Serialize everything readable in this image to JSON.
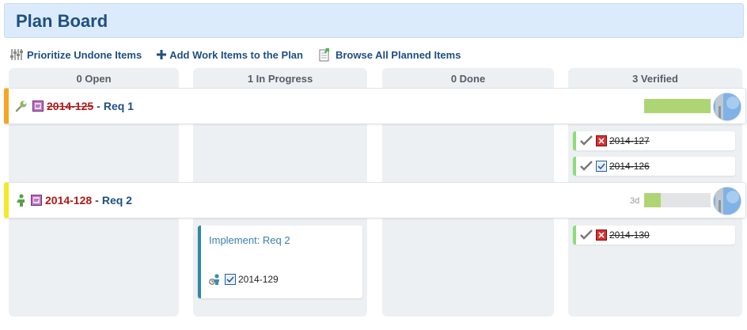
{
  "header": {
    "title": "Plan Board"
  },
  "toolbar": {
    "prioritize_label": "Prioritize Undone Items",
    "add_label": "Add Work Items to the Plan",
    "browse_label": "Browse All Planned Items"
  },
  "columns": [
    {
      "label": "0 Open"
    },
    {
      "label": "1 In Progress"
    },
    {
      "label": "0 Done"
    },
    {
      "label": "3 Verified"
    }
  ],
  "swimlanes": [
    {
      "id": "2014-125",
      "separator": "-",
      "title": "Req 1",
      "progress_fraction": 1.0,
      "accent": "#f5a623",
      "icon": "wrench-icon",
      "tasks": [
        {
          "id": "2014-127",
          "icon": "bug-icon"
        },
        {
          "id": "2014-126",
          "icon": "checkbox-icon"
        }
      ]
    },
    {
      "id": "2014-128",
      "separator": "-",
      "title": "Req 2",
      "remaining": "3d",
      "progress_fraction": 0.25,
      "accent": "#f4ea24",
      "icon": "person-icon",
      "card": {
        "title": "Implement: Req 2",
        "id": "2014-129"
      },
      "tasks": [
        {
          "id": "2014-130",
          "icon": "bug-icon"
        }
      ]
    }
  ],
  "colors": {
    "accent": "#1e4f82",
    "id_red": "#b01818",
    "progress_green": "#aed573",
    "done_green": "#8fdc7a"
  }
}
